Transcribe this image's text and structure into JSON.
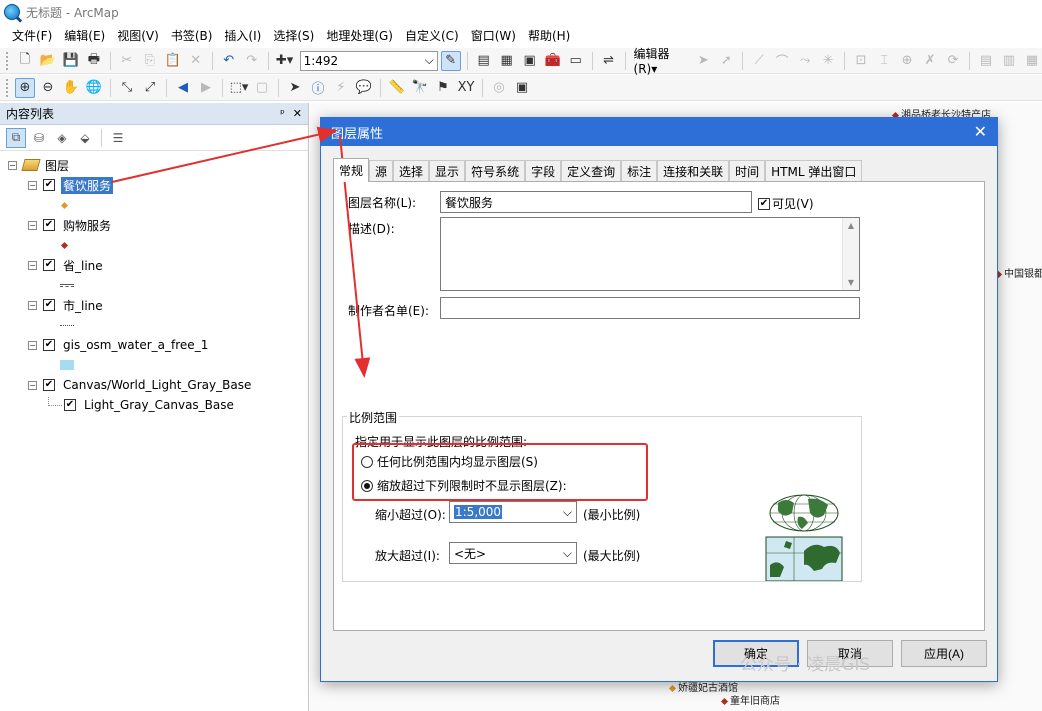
{
  "window": {
    "title": "无标题 - ArcMap"
  },
  "menu": [
    "文件(F)",
    "编辑(E)",
    "视图(V)",
    "书签(B)",
    "插入(I)",
    "选择(S)",
    "地理处理(G)",
    "自定义(C)",
    "窗口(W)",
    "帮助(H)"
  ],
  "toolbar": {
    "scale": "1:492",
    "editor_label": "编辑器(R)▾"
  },
  "toc": {
    "title": "内容列表",
    "header_controls": [
      "ᵖ",
      "✕"
    ],
    "root": "图层",
    "layers": [
      "餐饮服务",
      "购物服务",
      "省_line",
      "市_line",
      "gis_osm_water_a_free_1",
      "Canvas/World_Light_Gray_Base",
      "Light_Gray_Canvas_Base"
    ]
  },
  "map": {
    "labels": [
      "湘品桥老长沙特产店",
      "中国银都",
      "娇疆妃古酒馆",
      "童年旧商店"
    ]
  },
  "dialog": {
    "title": "图层属性",
    "tabs": [
      "常规",
      "源",
      "选择",
      "显示",
      "符号系统",
      "字段",
      "定义查询",
      "标注",
      "连接和关联",
      "时间",
      "HTML 弹出窗口"
    ],
    "layer_name_label": "图层名称(L):",
    "layer_name_value": "餐饮服务",
    "visible_label": "可见(V)",
    "description_label": "描述(D):",
    "credits_label": "制作者名单(E):",
    "scale_group_title": "比例范围",
    "scale_instruction": "指定用于显示此图层的比例范围:",
    "radio_all": "任何比例范围内均显示图层(S)",
    "radio_limit": "缩放超过下列限制时不显示图层(Z):",
    "min_scale_label": "缩小超过(O):",
    "min_scale_value": "1:5,000",
    "min_scale_note": "(最小比例)",
    "max_scale_label": "放大超过(I):",
    "max_scale_value": "<无>",
    "max_scale_note": "(最大比例)",
    "buttons": {
      "ok": "确定",
      "cancel": "取消",
      "apply": "应用(A)"
    }
  },
  "watermark": "公众号 · 凌晨GIS",
  "colors": {
    "dialog_title": "#2d6fd6",
    "selection": "#3a78c8",
    "annotation_red": "#e23030"
  }
}
